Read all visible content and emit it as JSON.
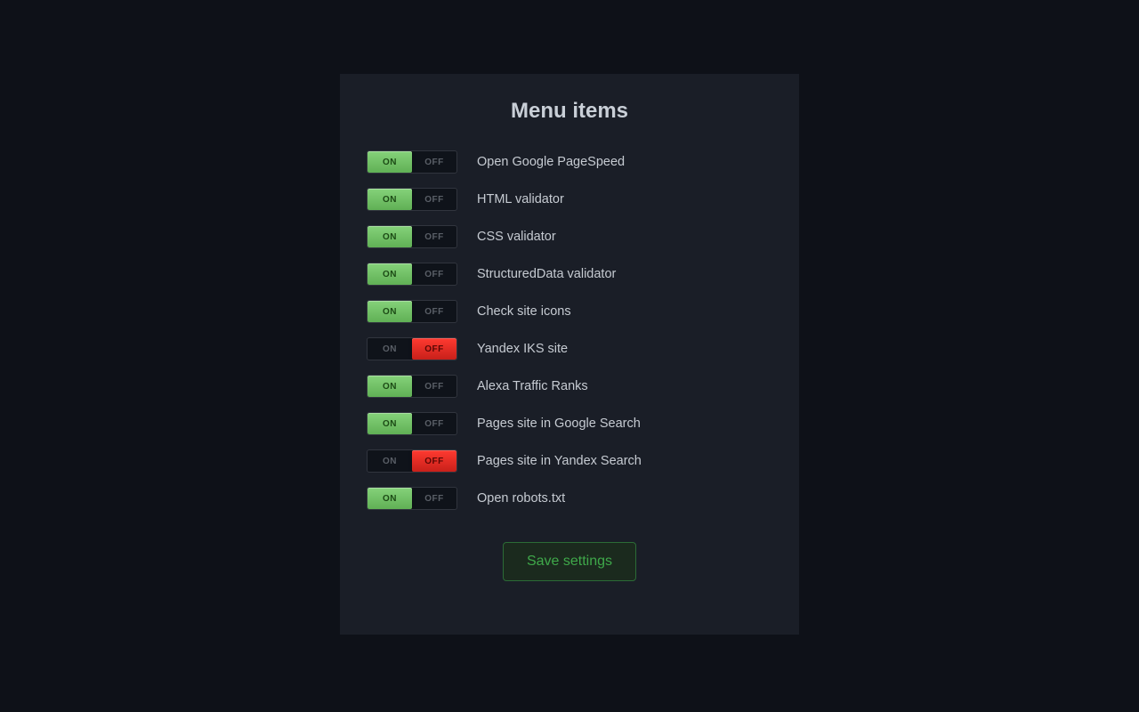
{
  "panel": {
    "title": "Menu items",
    "toggle_labels": {
      "on": "ON",
      "off": "OFF"
    },
    "items": [
      {
        "label": "Open Google PageSpeed",
        "state": "on"
      },
      {
        "label": "HTML validator",
        "state": "on"
      },
      {
        "label": "CSS validator",
        "state": "on"
      },
      {
        "label": "StructuredData validator",
        "state": "on"
      },
      {
        "label": "Check site icons",
        "state": "on"
      },
      {
        "label": "Yandex IKS site",
        "state": "off"
      },
      {
        "label": "Alexa Traffic Ranks",
        "state": "on"
      },
      {
        "label": "Pages site in Google Search",
        "state": "on"
      },
      {
        "label": "Pages site in Yandex Search",
        "state": "off"
      },
      {
        "label": "Open robots.txt",
        "state": "on"
      }
    ],
    "save_label": "Save settings"
  }
}
